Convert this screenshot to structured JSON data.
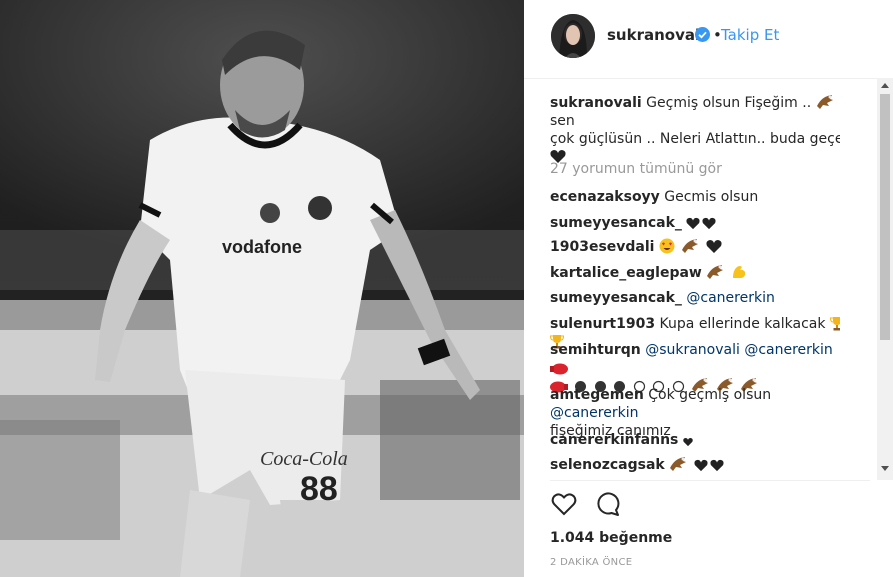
{
  "header": {
    "username": "sukranovali",
    "separator": "•",
    "follow_label": "Takip Et"
  },
  "caption": {
    "username": "sukranovali",
    "text_line1": "Geçmiş olsun Fişeğim ..",
    "text_line1b": "sen",
    "text_line2": "çok güçlüsün .. Neleri Atlattın.. buda geçer"
  },
  "view_all": "27 yorumun tümünü gör",
  "comments": [
    {
      "username": "ecenazaksoyy",
      "text": "Gecmis olsun"
    },
    {
      "username": "sumeyyesancak_",
      "text": ""
    },
    {
      "username": "1903esevdali",
      "text": ""
    },
    {
      "username": "kartalice_eaglepaw",
      "text": ""
    },
    {
      "username": "sumeyyesancak_",
      "mention": "@canererkin"
    },
    {
      "username": "sulenurt1903",
      "text": "Kupa ellerinde kalkacak"
    },
    {
      "username": "semihturqn",
      "mention1": "@sukranovali",
      "mention2": "@canererkin"
    },
    {
      "username": "amtegemen",
      "text": "Çok geçmiş olsun",
      "mention": "@canererkin",
      "text2": "fişeğimiz canımız"
    },
    {
      "username": "canererkinfanns",
      "text": ""
    },
    {
      "username": "selenozcagsak",
      "text": ""
    }
  ],
  "actions": {
    "likes": "1.044 beğenme",
    "timestamp": "2 DAKİKA ÖNCE"
  },
  "icons": [
    "verified-badge-icon",
    "heart-icon",
    "comment-bubble-icon",
    "eagle-emoji-icon",
    "black-heart-emoji-icon",
    "trophy-emoji-icon",
    "flexed-bicep-emoji-icon",
    "heart-eyes-emoji-icon",
    "boxing-glove-emoji-icon"
  ],
  "colors": {
    "link": "#3897f0",
    "mention": "#003569",
    "muted": "#999999",
    "text": "#262626"
  }
}
